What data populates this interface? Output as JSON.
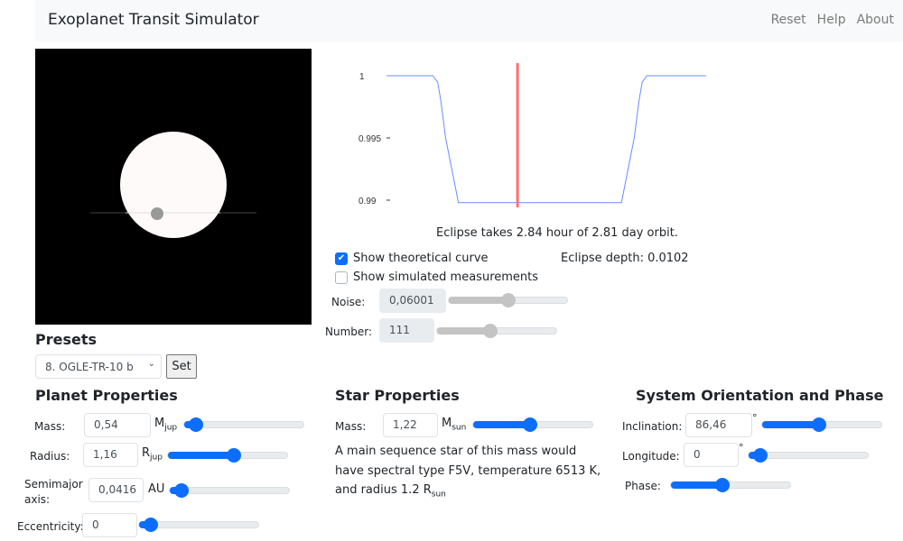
{
  "app": {
    "title": "Exoplanet Transit Simulator",
    "nav": [
      "Reset",
      "Help",
      "About"
    ]
  },
  "colors": {
    "accent": "#0d6efd",
    "curve": "#6a8cff",
    "phase_marker": "#ff6f6f",
    "star": "#fffafa",
    "planet": "#999999"
  },
  "chart_data": {
    "type": "line",
    "title": "",
    "xlabel": "",
    "ylabel": "",
    "ylim": [
      0.99,
      1.0
    ],
    "yticks": [
      "1",
      "0.995",
      "0.99"
    ],
    "ytick_values": [
      1.0,
      0.995,
      0.99
    ],
    "x": [
      0,
      0.145,
      0.16,
      0.17,
      0.185,
      0.225,
      0.425,
      0.735,
      0.775,
      0.79,
      0.8,
      0.815,
      1.0
    ],
    "series": [
      {
        "name": "theoretical curve",
        "values": [
          1.0,
          1.0,
          0.9995,
          0.998,
          0.995,
          0.9898,
          0.9898,
          0.9898,
          0.995,
          0.998,
          0.9995,
          1.0,
          1.0
        ]
      }
    ],
    "phase_marker_x": 0.41
  },
  "light_curve": {
    "eclipse_text": "Eclipse takes 2.84 hour of 2.81 day orbit.",
    "eclipse_depth": "Eclipse depth: 0.0102",
    "show_theoretical": {
      "label": "Show theoretical curve",
      "checked": true
    },
    "show_measurements": {
      "label": "Show simulated measurements",
      "checked": false
    },
    "noise": {
      "label": "Noise:",
      "value": "0,06001",
      "slider": 0.5
    },
    "number": {
      "label": "Number:",
      "value": "111",
      "slider": 0.45
    }
  },
  "presets": {
    "heading": "Presets",
    "selected": "8. OGLE-TR-10 b",
    "set_label": "Set"
  },
  "planet": {
    "heading": "Planet Properties",
    "mass": {
      "label": "Mass:",
      "value": "0,54",
      "unit": "M",
      "unit_sub": "jup",
      "slider": 0.1
    },
    "radius": {
      "label": "Radius:",
      "value": "1,16",
      "unit": "R",
      "unit_sub": "jup",
      "slider": 0.55
    },
    "semimajor": {
      "label": "Semimajor axis:",
      "label1": "Semimajor",
      "label2": "axis:",
      "value": "0,0416",
      "unit": "AU",
      "slider": 0.1
    },
    "eccentricity": {
      "label": "Eccentricity:",
      "value": "0",
      "slider": 0.1
    }
  },
  "star": {
    "heading": "Star Properties",
    "mass": {
      "label": "Mass:",
      "value": "1,22",
      "unit": "M",
      "unit_sub": "sun",
      "slider": 0.48
    },
    "desc_main": "A main sequence star of this mass would have spectral type F5V, temperature 6513 K, and radius 1.2 R",
    "desc_sub": "sun"
  },
  "orientation": {
    "heading": "System Orientation and Phase",
    "inclination": {
      "label": "Inclination:",
      "value": "86,46",
      "unit": "°",
      "slider": 0.48
    },
    "longitude": {
      "label": "Longitude:",
      "value": "0",
      "unit": "°",
      "slider": 0.1
    },
    "phase": {
      "label": "Phase:",
      "slider": 0.43
    }
  }
}
